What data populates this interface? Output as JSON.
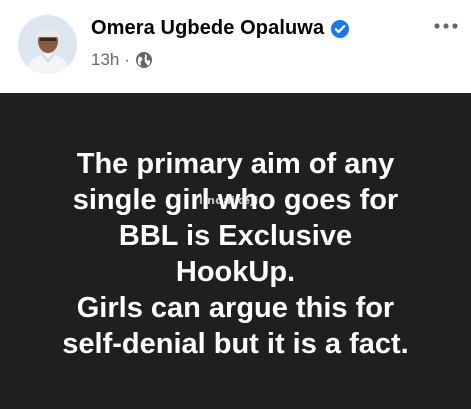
{
  "post": {
    "author": "Omera Ugbede Opaluwa",
    "verified_icon": "verified-badge-icon",
    "time": "13h",
    "separator": "·",
    "audience_icon": "globe-icon",
    "more_icon": "more-options-icon",
    "text_lines": [
      "The primary aim of any",
      "single girl who goes for",
      "BBL is Exclusive",
      "HookUp.",
      "Girls can argue this for",
      "self-denial but it is a fact."
    ],
    "watermark": "lindaikeji"
  },
  "colors": {
    "verified": "#1877f2",
    "body_bg": "#1f1f1f",
    "meta": "#65676b"
  }
}
